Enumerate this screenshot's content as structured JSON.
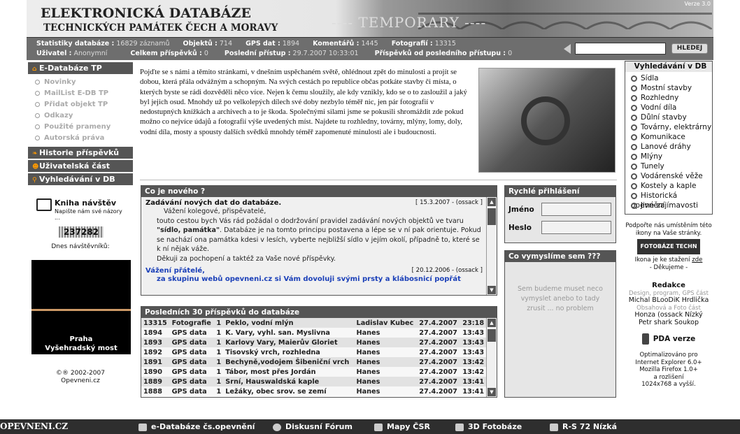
{
  "header": {
    "title_line1": "ELEKTRONICKÁ DATABÁZE",
    "title_line2": "TECHNICKÝCH PAMÁTEK ČECH A MORAVY",
    "temporary": "---- TEMPORARY ----",
    "version": "Verze 3.0"
  },
  "stats": {
    "row1": [
      {
        "label": "Statistiky databáze :",
        "value": "16829 záznamů"
      },
      {
        "label": "Objektů :",
        "value": "714"
      },
      {
        "label": "GPS dat :",
        "value": "1894"
      },
      {
        "label": "Komentářů :",
        "value": "1445"
      },
      {
        "label": "Fotografií :",
        "value": "13315"
      }
    ],
    "row2": [
      {
        "label": "Uživatel :",
        "value": "Anonymní"
      },
      {
        "label": "Celkem příspěvků :",
        "value": "0"
      },
      {
        "label": "Poslední přístup :",
        "value": "29.7.2007 10:33:01"
      },
      {
        "label": "Příspěvků od posledního přístupu :",
        "value": "0"
      }
    ]
  },
  "search": {
    "button": "HLEDEJ",
    "value": ""
  },
  "leftnav": {
    "edb": "E-Databáze TP",
    "sub": [
      "Novinky",
      "MailList E-DB TP",
      "Přidat objekt TP",
      "Odkazy",
      "Použité prameny",
      "Autorská práva"
    ],
    "history": "Historie příspěvků",
    "user": "Uživatelská část",
    "dbsearch": "Vyhledávání v DB"
  },
  "guestbook": {
    "title": "Kniha návštěv",
    "subtitle": "Napište nám své názory ...",
    "counter": "237282",
    "visits_label": "Dnes návštěvníků:"
  },
  "photo": {
    "caption1": "Praha",
    "caption2": "Vyšehradský most"
  },
  "copyright": {
    "line1": "©® 2002-2007",
    "line2": "Opevneni.cz"
  },
  "intro": "Pojďte se s námi a těmito stránkami, v dnešním uspěchaném světě, ohlédnout zpět do minulosti a projít se dobou, která přála odvážným a schopným. Na svých cestách po republice občas potkáte stavby či místa, o kterých byste se rádi dozvěděli něco více. Nejen k čemu sloužily, ale kdy vznikly, kdo se o to zasloužil a jaký byl jejich osud. Mnohdy už po velkolepých dílech své doby nezbylo téměř nic, jen pár fotografií v nedostupných knížkách a archivech a to je škoda. Společnými silami jsme se pokusili shromáždit zde pokud možno co nejvíce údajů a fotografií výše uvedených míst. Najdete tu rozhledny, továrny, mlýny, lomy, doly, vodní díla, mosty a spousty dalších svědků mnohdy téměř zapomenuté minulosti ale i budoucnosti.",
  "news": {
    "title": "Co je nového ?",
    "item1_title": "Zadávání nových dat do databáze.",
    "item1_date": "[ 15.3.2007 - (ossack ]",
    "item1_text_a": "Vážení kolegové, přispěvatelé,",
    "item1_text_b": "touto cestou bych Vás rád požádal o dodržování pravidel zadávání nových objektů ve tvaru",
    "item1_text_bold": "\"sídlo, památka\"",
    "item1_text_c": ". Databáze je na tomto principu postavena a lépe se v ní pak orientuje. Pokud se nachází ona památka kdesi v lesích, vyberte nejbližší sídlo v jejím okolí, případně to, které se k ní nějak váže.",
    "item1_text_d": "Děkuji za pochopení a taktéž za Vaše nové příspěvky.",
    "item2_title": "Vážení přátelé,",
    "item2_date": "[ 20.12.2006 - (ossack ]",
    "item2_text": "za skupinu webů opevneni.cz si Vám dovoluji svými prsty a klábosnicí popřát"
  },
  "posts": {
    "title": "Posledních 30 příspěvků do databáze",
    "rows": [
      [
        "13315",
        "Fotografie",
        "1",
        "Peklo, vodní mlýn",
        "Ladislav Kubec",
        "27.4.2007",
        "23:18"
      ],
      [
        "1894",
        "GPS data",
        "1",
        "K. Vary, vyhl. san. Myslivna",
        "Hanes",
        "27.4.2007",
        "13:43"
      ],
      [
        "1893",
        "GPS data",
        "1",
        "Karlovy Vary, Maierův Gloriet",
        "Hanes",
        "27.4.2007",
        "13:43"
      ],
      [
        "1892",
        "GPS data",
        "1",
        "Tisovský vrch, rozhledna",
        "Hanes",
        "27.4.2007",
        "13:43"
      ],
      [
        "1891",
        "GPS data",
        "1",
        "Bechyně,vodojem Šibeniční vrch",
        "Hanes",
        "27.4.2007",
        "13:42"
      ],
      [
        "1890",
        "GPS data",
        "1",
        "Tábor, most přes Jordán",
        "Hanes",
        "27.4.2007",
        "13:42"
      ],
      [
        "1889",
        "GPS data",
        "1",
        "Srní, Hauswaldská kaple",
        "Hanes",
        "27.4.2007",
        "13:41"
      ],
      [
        "1888",
        "GPS data",
        "1",
        "Ležáky, obec srov. se zemí",
        "Hanes",
        "27.4.2007",
        "13:41"
      ]
    ]
  },
  "login": {
    "title": "Rychlé přihlášení",
    "user_label": "Jméno",
    "pass_label": "Heslo"
  },
  "thinkup": {
    "title": "Co vymyslíme sem ???",
    "text1": "Sem budeme muset neco",
    "text2": "vymyslet anebo to tady",
    "text3": "zrusit ... no problem"
  },
  "dbsearch": {
    "title": "Vyhledávání v DB",
    "items": [
      "Sídla",
      "Mostní stavby",
      "Rozhledny",
      "Vodní díla",
      "Důlní stavby",
      "Továrny, elektrárny",
      "Komunikace",
      "Lanové dráhy",
      "Mlýny",
      "Tunely",
      "Vodárenské věže",
      "Kostely a kaple",
      "Historická opevnění",
      "Jiné zajímavosti"
    ]
  },
  "rightcol": {
    "support": "Podpořte nás umístěním této ikony na Vaše stránky.",
    "logo": "FOTOBÁZE TECHN",
    "icon_line1": "Ikona je ke stažení",
    "icon_link": "zde",
    "icon_line2": "- Děkujeme -",
    "redakce": "Redakce",
    "r1": "Design, program, GPS část",
    "r2": "Michal BLooDiK Hrdlička",
    "r3": "Obsahová a Foto část",
    "r4": "Honza (ossack Nízký",
    "r5": "Petr shark Soukop",
    "pda": "PDA verze",
    "opt1": "Optimalizováno pro",
    "opt2": "Internet Explorer 6.0+",
    "opt3": "Mozilla Firefox 1.0+",
    "opt4": "a rozlišení",
    "opt5": "1024x768 a vyšší."
  },
  "footer": {
    "site": "OPEVNENI.CZ",
    "links": [
      "e-Databáze čs.opevnění",
      "Diskusní Fórum",
      "Mapy ČSR",
      "3D Fotobáze",
      "R-S 72 Nízká"
    ]
  }
}
